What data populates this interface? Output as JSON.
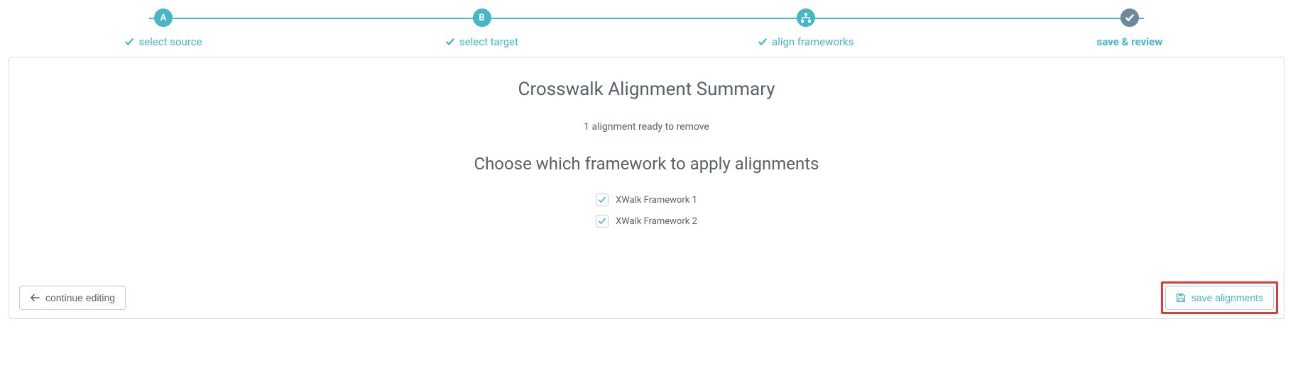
{
  "stepper": {
    "steps": [
      {
        "badge": "A",
        "label": "select source",
        "done": true
      },
      {
        "badge": "B",
        "label": "select target",
        "done": true
      },
      {
        "badge": "sitemap",
        "label": "align frameworks",
        "done": true
      },
      {
        "badge": "check",
        "label": "save & review",
        "active": true
      }
    ]
  },
  "panel": {
    "title": "Crosswalk Alignment Summary",
    "status": "1 alignment ready to remove",
    "chooseHeading": "Choose which framework to apply alignments",
    "frameworks": [
      {
        "label": "XWalk Framework 1",
        "checked": true
      },
      {
        "label": "XWalk Framework 2",
        "checked": true
      }
    ],
    "continueLabel": "continue editing",
    "saveLabel": "save alignments"
  }
}
